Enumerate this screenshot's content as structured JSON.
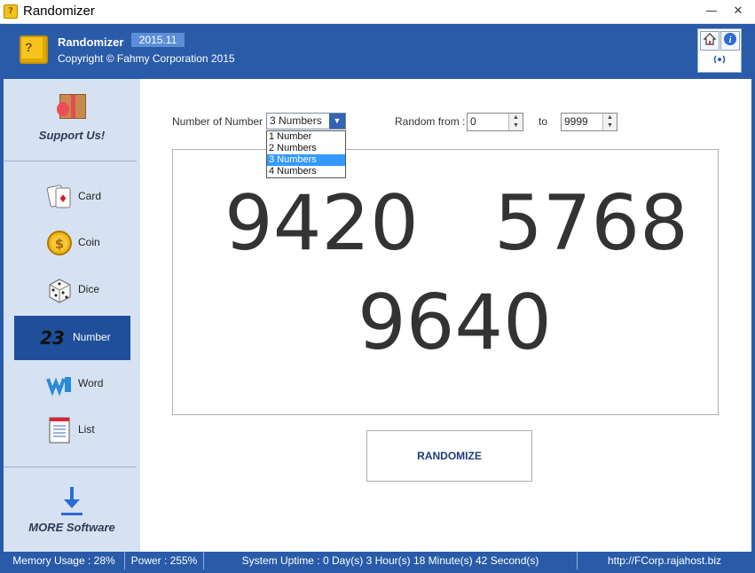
{
  "window": {
    "title": "Randomizer",
    "minimize": "—",
    "close": "✕"
  },
  "header": {
    "app_name": "Randomizer",
    "version": "2015.11",
    "copyright": "Copyright © Fahmy Corporation 2015"
  },
  "toolbar": {
    "home_icon": "home-icon",
    "info_icon": "info-icon",
    "broadcast_icon": "broadcast-icon"
  },
  "sidebar": {
    "support_label": "Support Us!",
    "items": [
      {
        "label": "Card",
        "icon": "cards-icon"
      },
      {
        "label": "Coin",
        "icon": "coin-icon"
      },
      {
        "label": "Dice",
        "icon": "dice-icon"
      },
      {
        "label": "Number",
        "icon": "number-icon",
        "icon_text": "23",
        "active": true
      },
      {
        "label": "Word",
        "icon": "word-icon"
      },
      {
        "label": "List",
        "icon": "list-icon"
      }
    ],
    "more_label": "MORE Software"
  },
  "controls": {
    "number_of_number_label": "Number of Number :",
    "selected": "3 Numbers",
    "options": [
      "1 Number",
      "2 Numbers",
      "3 Numbers",
      "4 Numbers"
    ],
    "random_from_label": "Random from :",
    "from_value": "0",
    "to_label": "to",
    "to_value": "9999"
  },
  "results": [
    "9420",
    "5768",
    "9640"
  ],
  "randomize_label": "RANDOMIZE",
  "status": {
    "memory": "Memory Usage : 28%",
    "power": "Power : 255%",
    "uptime": "System Uptime : 0 Day(s) 3 Hour(s) 18 Minute(s) 42 Second(s)",
    "url": "http://FCorp.rajahost.biz"
  },
  "colors": {
    "brand_blue": "#2a5ba8",
    "sidebar_bg": "#d6e2f1",
    "active_nav": "#1f4e9a",
    "selection": "#3399ff"
  }
}
